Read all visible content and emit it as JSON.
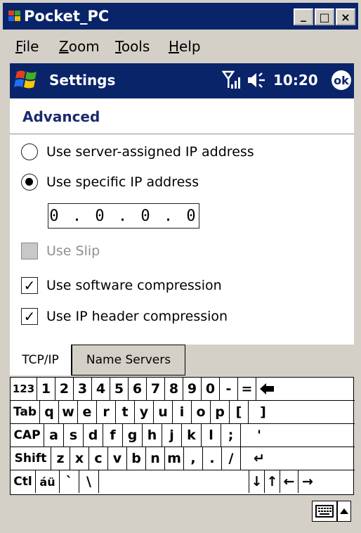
{
  "window": {
    "title": "Pocket_PC",
    "minimize": "_",
    "maximize": "□",
    "close": "×"
  },
  "menubar": {
    "items": [
      {
        "label": "File",
        "ul": "F",
        "rest": "ile"
      },
      {
        "label": "Zoom",
        "ul": "Z",
        "rest": "oom"
      },
      {
        "label": "Tools",
        "ul": "T",
        "rest": "ools"
      },
      {
        "label": "Help",
        "ul": "H",
        "rest": "elp"
      }
    ]
  },
  "nav": {
    "title": "Settings",
    "time": "10:20",
    "ok": "ok",
    "icons": [
      "start-icon",
      "signal-icon",
      "speaker-icon"
    ]
  },
  "page": {
    "heading": "Advanced",
    "radio_server": "Use server-assigned IP address",
    "radio_specific": "Use specific IP address",
    "selected_radio": "specific",
    "ip_value": "0 . 0 . 0 . 0",
    "use_slip": "Use Slip",
    "use_software_compression": "Use software compression",
    "use_ip_header_compression": "Use IP header compression",
    "software_compression_checked": true,
    "ip_header_compression_checked": true,
    "slip_enabled": false
  },
  "tabs": [
    {
      "label": "TCP/IP",
      "active": true
    },
    {
      "label": "Name Servers",
      "active": false
    }
  ],
  "keyboard": {
    "row1": [
      "123",
      "1",
      "2",
      "3",
      "4",
      "5",
      "6",
      "7",
      "8",
      "9",
      "0",
      "-",
      "=",
      "🡐"
    ],
    "row2": [
      "Tab",
      "q",
      "w",
      "e",
      "r",
      "t",
      "y",
      "u",
      "i",
      "o",
      "p",
      "[",
      "]"
    ],
    "row3": [
      "CAP",
      "a",
      "s",
      "d",
      "f",
      "g",
      "h",
      "j",
      "k",
      "l",
      ";",
      "'"
    ],
    "row4": [
      "Shift",
      "z",
      "x",
      "c",
      "v",
      "b",
      "n",
      "m",
      ",",
      ".",
      "/",
      "↵"
    ],
    "row5": [
      "Ctl",
      "áü",
      "`",
      "\\",
      "",
      "↓",
      "↑",
      "←",
      "→"
    ]
  },
  "colors": {
    "titlebar": "#0a246a",
    "heading": "#1b2a6e",
    "chrome": "#d4d0c8"
  }
}
